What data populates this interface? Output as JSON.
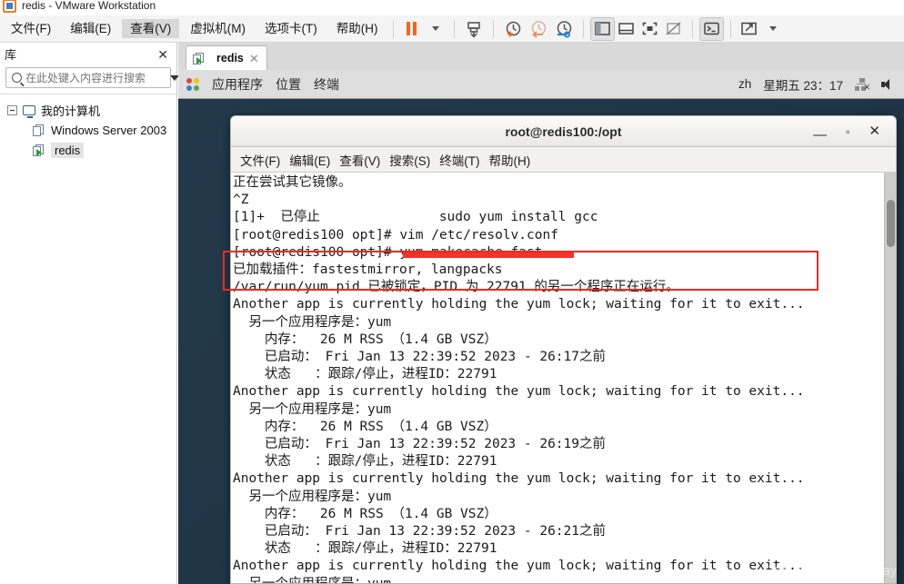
{
  "window": {
    "title": "redis - VMware Workstation",
    "logo_icon": "vmware-logo-icon"
  },
  "menubar": {
    "items": [
      {
        "label": "文件(F)",
        "active": false
      },
      {
        "label": "编辑(E)",
        "active": false
      },
      {
        "label": "查看(V)",
        "active": true
      },
      {
        "label": "虚拟机(M)",
        "active": false
      },
      {
        "label": "选项卡(T)",
        "active": false
      },
      {
        "label": "帮助(H)",
        "active": false
      }
    ],
    "toolbar_icons": [
      "pause-icon",
      "dropdown-caret-icon",
      "send-ctrl-alt-del-icon",
      "take-snapshot-icon",
      "revert-snapshot-icon",
      "snapshot-manager-icon",
      "show-library-icon",
      "show-thumbnails-icon",
      "full-screen-icon",
      "unity-mode-icon",
      "console-view-icon",
      "stretch-guest-icon",
      "stretch-dropdown-icon"
    ]
  },
  "library": {
    "title": "库",
    "close_label": "✕",
    "search": {
      "placeholder": "在此处键入内容进行搜索",
      "value": "",
      "icon": "search-icon",
      "dropdown_icon": "chevron-down-icon"
    },
    "tree": [
      {
        "label": "我的计算机",
        "level": 0,
        "icon": "my-computer-icon",
        "selected": false
      },
      {
        "label": "Windows Server 2003",
        "level": 1,
        "icon": "vm-icon",
        "selected": false
      },
      {
        "label": "redis",
        "level": 1,
        "icon": "vm-running-icon",
        "selected": true
      }
    ]
  },
  "tabs": [
    {
      "label": "redis",
      "icon": "vm-running-icon",
      "close_label": "✕",
      "active": true
    }
  ],
  "gnome_panel": {
    "apps_icon": "gnome-applications-icon",
    "menus": [
      "应用程序",
      "位置",
      "终端"
    ],
    "keyboard_layout": "zh",
    "clock": "星期五 23：17",
    "network_icon": "network-disconnected-icon",
    "volume_icon": "volume-icon"
  },
  "terminal": {
    "title": "root@redis100:/opt",
    "window_buttons": {
      "minimize": "—",
      "maximize": "▫",
      "close": "✕"
    },
    "menus": [
      "文件(F)",
      "编辑(E)",
      "查看(V)",
      "搜索(S)",
      "终端(T)",
      "帮助(H)"
    ],
    "lines": [
      "正在尝试其它镜像。",
      "^Z",
      "[1]+  已停止               sudo yum install gcc",
      "[root@redis100 opt]# vim /etc/resolv.conf",
      "[root@redis100 opt]# yum makecache fast",
      "已加载插件：fastestmirror, langpacks",
      "/var/run/yum.pid 已被锁定，PID 为 22791 的另一个程序正在运行。",
      "Another app is currently holding the yum lock; waiting for it to exit...",
      "  另一个应用程序是：yum",
      "    内存：  26 M RSS （1.4 GB VSZ）",
      "    已启动： Fri Jan 13 22:39:52 2023 - 26:17之前",
      "    状态   ：跟踪/停止，进程ID：22791",
      "Another app is currently holding the yum lock; waiting for it to exit...",
      "  另一个应用程序是：yum",
      "    内存：  26 M RSS （1.4 GB VSZ）",
      "    已启动： Fri Jan 13 22:39:52 2023 - 26:19之前",
      "    状态   ：跟踪/停止，进程ID：22791",
      "Another app is currently holding the yum lock; waiting for it to exit...",
      "  另一个应用程序是：yum",
      "    内存：  26 M RSS （1.4 GB VSZ）",
      "    已启动： Fri Jan 13 22:39:52 2023 - 26:21之前",
      "    状态   ：跟踪/停止，进程ID：22791",
      "Another app is currently holding the yum lock; waiting for it to exit...",
      "  另一个应用程序是：yum"
    ]
  },
  "annotations": {
    "highlight_color": "#ec2a20",
    "bar_color": "#f4332a"
  },
  "watermark": {
    "text": "CSDN @born_thisway"
  }
}
